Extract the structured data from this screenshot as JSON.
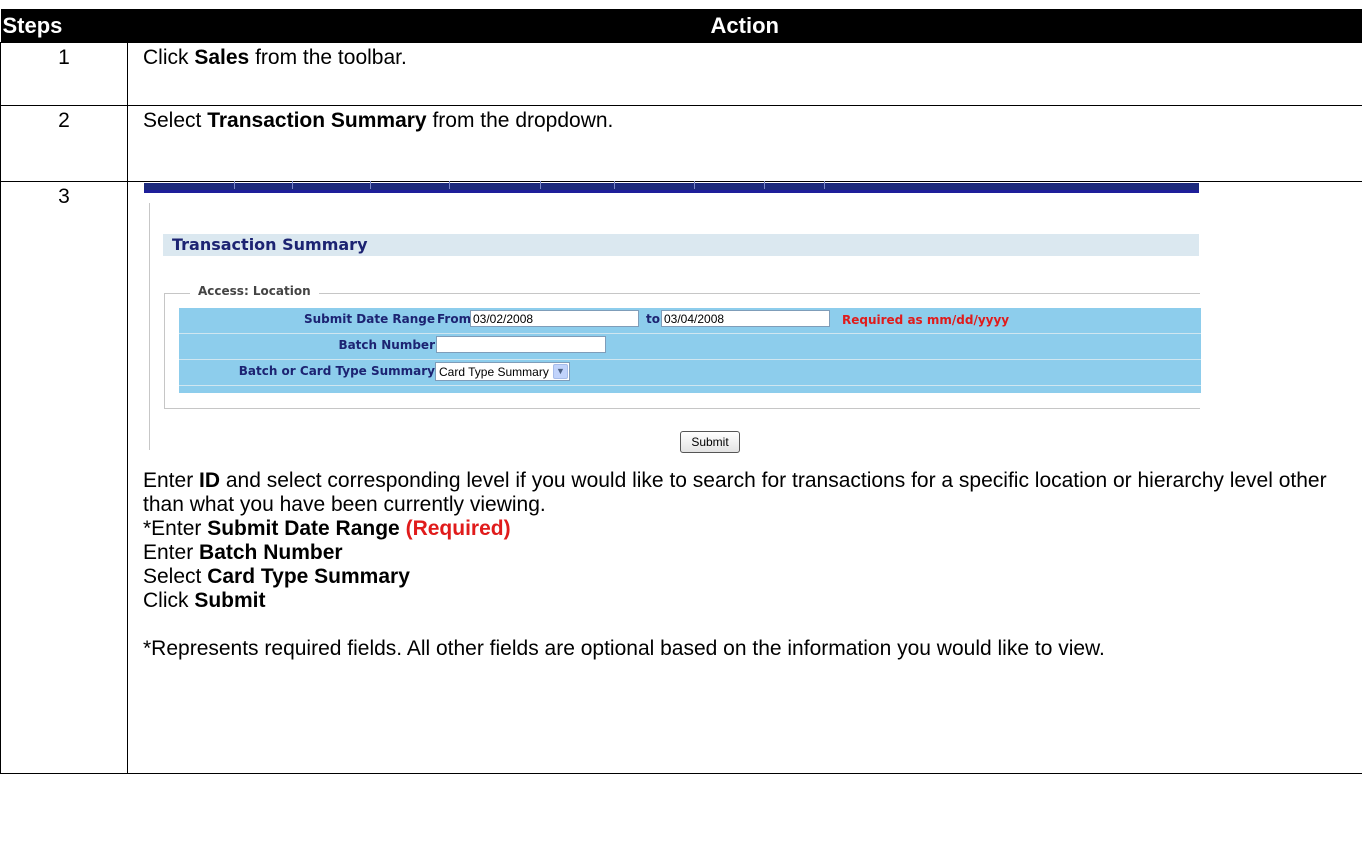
{
  "headers": {
    "steps": "Steps",
    "action": "Action"
  },
  "step1": {
    "number": "1",
    "pre": "Click ",
    "bold": "Sales",
    "post": " from the toolbar."
  },
  "step2": {
    "number": "2",
    "pre": "Select ",
    "bold": "Transaction Summary",
    "post": " from the dropdown."
  },
  "step3": {
    "number": "3",
    "screenshot": {
      "title": "Transaction Summary",
      "legend": "Access: Location",
      "submit_date_label": "Submit Date Range",
      "from_label": "From",
      "from_value": "03/02/2008",
      "to_label": "to",
      "to_value": "03/04/2008",
      "required_note": "Required as mm/dd/yyyy",
      "batch_number_label": "Batch Number",
      "batch_number_value": "",
      "summary_label": "Batch or Card Type Summary",
      "summary_value": "Card Type Summary",
      "submit_button": "Submit",
      "nav_color": "#1c2a7c",
      "form_color": "#8dcdec"
    },
    "instructions": {
      "p1_pre": "Enter ",
      "p1_bold": "ID",
      "p1_post": " and select corresponding level if you would like to search for transactions for a specific location or hierarchy level other than what you have been currently viewing.",
      "p2_pre": "*Enter ",
      "p2_bold": "Submit Date Range",
      "p2_red": "(Required)",
      "p3_pre": "Enter ",
      "p3_bold": "Batch Number",
      "p4_pre": "Select ",
      "p4_bold": "Card Type Summary",
      "p5_pre": "Click ",
      "p5_bold": "Submit",
      "note": "*Represents required fields. All other fields are optional based on the information you would like to view."
    }
  }
}
